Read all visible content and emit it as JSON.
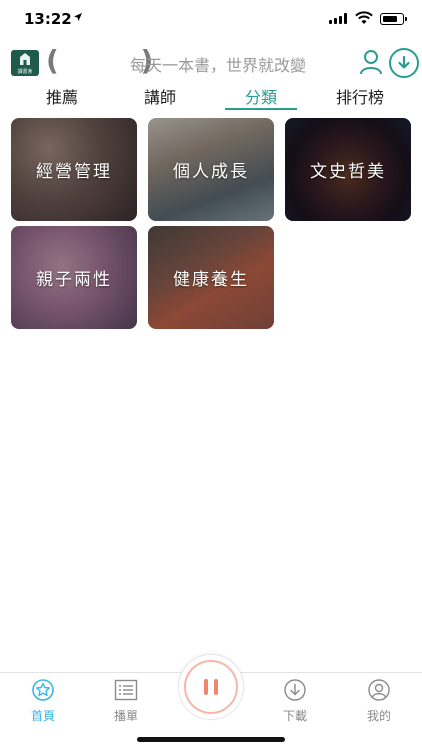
{
  "status_bar": {
    "time": "13:22"
  },
  "header": {
    "logo_text": "讀書會",
    "brackets": "( )",
    "slogan": "每天一本書，世界就改變"
  },
  "tabs": [
    {
      "label": "推薦",
      "active": false
    },
    {
      "label": "講師",
      "active": false
    },
    {
      "label": "分類",
      "active": true
    },
    {
      "label": "排行榜",
      "active": false
    }
  ],
  "categories": [
    {
      "label": "經營管理"
    },
    {
      "label": "個人成長"
    },
    {
      "label": "文史哲美"
    },
    {
      "label": "親子兩性"
    },
    {
      "label": "健康養生"
    }
  ],
  "bottom_nav": [
    {
      "label": "首頁",
      "icon": "home-star-icon",
      "active": true
    },
    {
      "label": "播單",
      "icon": "playlist-icon",
      "active": false
    },
    {
      "label": "下載",
      "icon": "download-icon",
      "active": false
    },
    {
      "label": "我的",
      "icon": "profile-icon",
      "active": false
    }
  ],
  "colors": {
    "accent": "#2a9d8f",
    "nav_active": "#39b5e6",
    "player_accent": "#f0856b"
  }
}
